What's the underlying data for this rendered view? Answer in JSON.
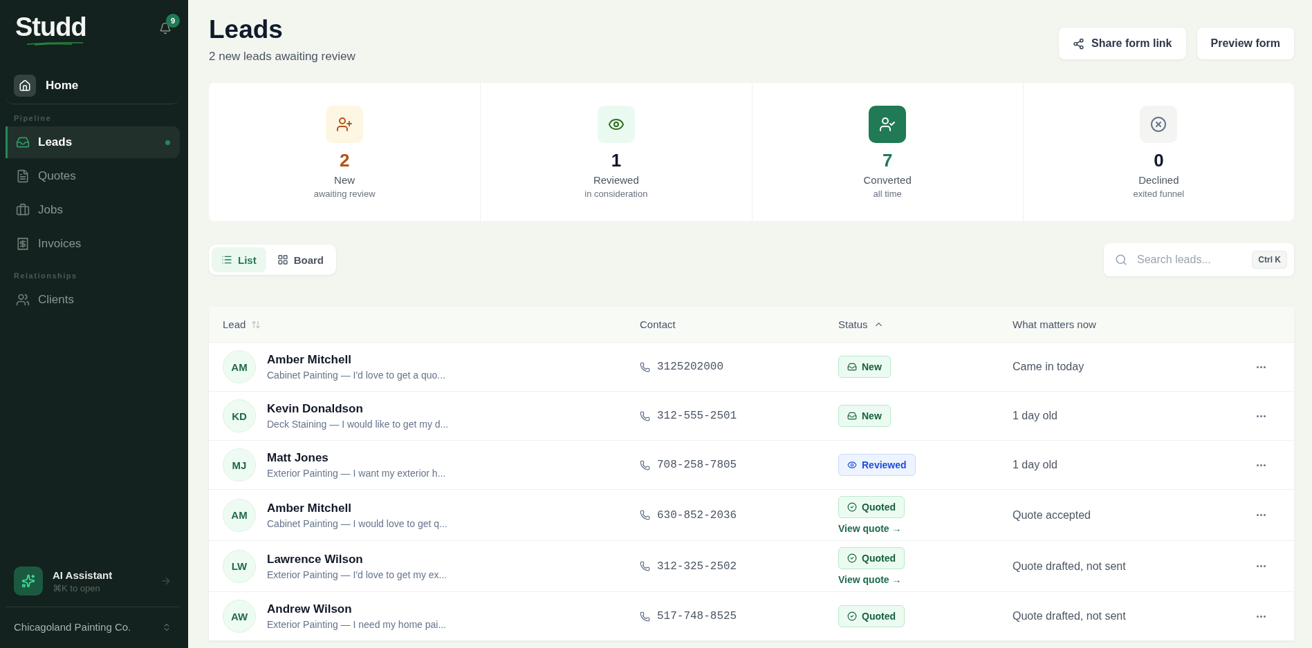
{
  "sidebar": {
    "logo": "Studd",
    "notification_count": "9",
    "home": {
      "label": "Home",
      "selected": false
    },
    "sections": [
      {
        "label": "Pipeline",
        "items": [
          {
            "label": "Leads",
            "selected": true,
            "dot": true
          },
          {
            "label": "Quotes",
            "selected": false,
            "dot": false
          },
          {
            "label": "Jobs",
            "selected": false,
            "dot": false
          },
          {
            "label": "Invoices",
            "selected": false,
            "dot": false
          }
        ]
      },
      {
        "label": "Relationships",
        "items": [
          {
            "label": "Clients",
            "selected": false,
            "dot": false
          }
        ]
      }
    ],
    "assistant": {
      "title": "AI Assistant",
      "hint": "⌘K to open"
    },
    "workspace": "Chicagoland Painting Co."
  },
  "header": {
    "title": "Leads",
    "subtitle": "2 new leads awaiting review",
    "buttons": [
      {
        "label": "Share form link",
        "kind": "share"
      },
      {
        "label": "Preview form",
        "kind": "plain"
      }
    ]
  },
  "stats": [
    {
      "kind": "new",
      "value": "2",
      "label": "New",
      "sub": "awaiting review"
    },
    {
      "kind": "reviewed",
      "value": "1",
      "label": "Reviewed",
      "sub": "in consideration"
    },
    {
      "kind": "converted",
      "value": "7",
      "label": "Converted",
      "sub": "all time"
    },
    {
      "kind": "declined",
      "value": "0",
      "label": "Declined",
      "sub": "exited funnel"
    }
  ],
  "view_toggle": [
    {
      "label": "List",
      "selected": true
    },
    {
      "label": "Board",
      "selected": false
    }
  ],
  "search": {
    "placeholder": "Search leads...",
    "shortcut": "Ctrl K"
  },
  "table": {
    "columns": [
      {
        "label": "Lead",
        "kind": "sortable"
      },
      {
        "label": "Contact",
        "kind": "plain"
      },
      {
        "label": "Status",
        "kind": "sorted"
      },
      {
        "label": "What matters now",
        "kind": "plain"
      }
    ],
    "rows": [
      {
        "initials": "AM",
        "name": "Amber Mitchell",
        "snippet": "Cabinet Painting — I'd love to get a quo...",
        "phone": "3125202000",
        "status": {
          "kind": "new",
          "label": "New"
        },
        "note": "Came in today"
      },
      {
        "initials": "KD",
        "name": "Kevin Donaldson",
        "snippet": "Deck Staining — I would like to get my d...",
        "phone": "312-555-2501",
        "status": {
          "kind": "new",
          "label": "New"
        },
        "note": "1 day old"
      },
      {
        "initials": "MJ",
        "name": "Matt Jones",
        "snippet": "Exterior Painting — I want my exterior h...",
        "phone": "708-258-7805",
        "status": {
          "kind": "reviewed",
          "label": "Reviewed"
        },
        "note": "1 day old"
      },
      {
        "initials": "AM",
        "name": "Amber Mitchell",
        "snippet": "Cabinet Painting — I would love to get q...",
        "phone": "630-852-2036",
        "status": {
          "kind": "quoted",
          "label": "Quoted"
        },
        "link": "View quote →",
        "note": "Quote accepted"
      },
      {
        "initials": "LW",
        "name": "Lawrence Wilson",
        "snippet": "Exterior Painting — I'd love to get my ex...",
        "phone": "312-325-2502",
        "status": {
          "kind": "quoted",
          "label": "Quoted"
        },
        "link": "View quote →",
        "note": "Quote drafted, not sent"
      },
      {
        "initials": "AW",
        "name": "Andrew Wilson",
        "snippet": "Exterior Painting — I need my home pai...",
        "phone": "517-748-8525",
        "status": {
          "kind": "quoted",
          "label": "Quoted"
        },
        "note": "Quote drafted, not sent"
      }
    ]
  }
}
